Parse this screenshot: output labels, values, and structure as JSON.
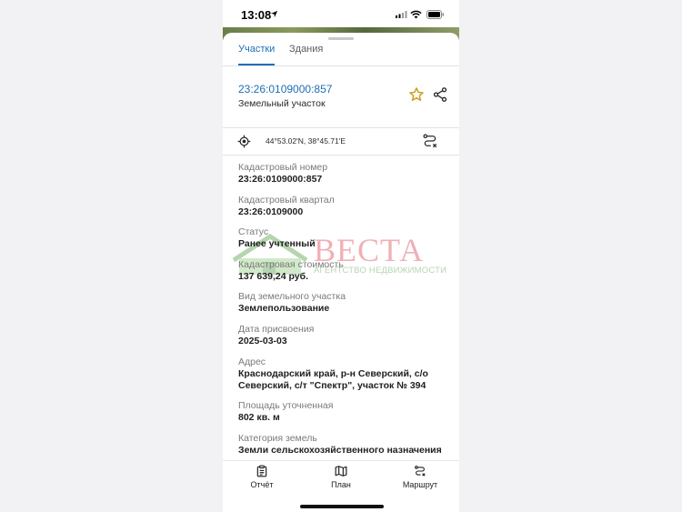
{
  "status_bar": {
    "time": "13:08"
  },
  "tabs": [
    {
      "label": "Участки",
      "active": true
    },
    {
      "label": "Здания",
      "active": false
    }
  ],
  "header": {
    "cadastral_link": "23:26:0109000:857",
    "object_type": "Земельный участок"
  },
  "coords": {
    "text": "44°53.02'N, 38°45.71'E"
  },
  "fields": [
    {
      "label": "Кадастровый номер",
      "value": "23:26:0109000:857"
    },
    {
      "label": "Кадастровый квартал",
      "value": "23:26:0109000"
    },
    {
      "label": "Статус",
      "value": "Ранее учтенный"
    },
    {
      "label": "Кадастровая стоимость",
      "value": "137 639,24 руб."
    },
    {
      "label": "Вид земельного участка",
      "value": "Землепользование"
    },
    {
      "label": "Дата присвоения",
      "value": "2025-03-03"
    },
    {
      "label": "Адрес",
      "value": "Краснодарский край, р-н Северский, с/о Северский, с/т \"Спектр\", участок № 394"
    },
    {
      "label": "Площадь уточненная",
      "value": "802 кв. м"
    },
    {
      "label": "Категория земель",
      "value": "Земли сельскохозяйственного назначения"
    }
  ],
  "watermark": {
    "title": "ВЕСТА",
    "subtitle": "АГЕНТСТВО НЕДВИЖИМОСТИ"
  },
  "bottom_nav": [
    {
      "label": "Отчёт",
      "icon": "report-icon"
    },
    {
      "label": "План",
      "icon": "map-icon"
    },
    {
      "label": "Маршрут",
      "icon": "route-icon"
    }
  ],
  "colors": {
    "accent": "#1f6fb5",
    "star": "#c9a227",
    "watermark_red": "#e0525e",
    "watermark_green": "#5da34e"
  }
}
